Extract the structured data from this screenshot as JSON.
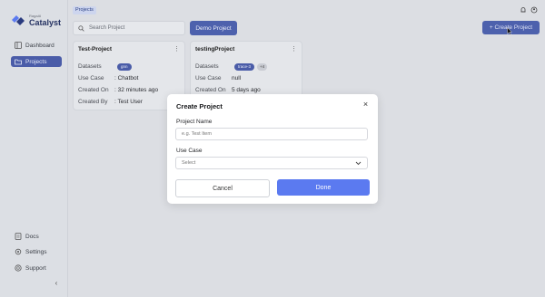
{
  "brand": {
    "line1": "RagaAI",
    "line2": "Catalyst"
  },
  "sidebar": {
    "items": [
      {
        "label": "Dashboard",
        "icon": "dashboard-icon",
        "active": false
      },
      {
        "label": "Projects",
        "icon": "folder-icon",
        "active": true
      }
    ],
    "bottom": [
      {
        "label": "Docs",
        "icon": "docs-icon"
      },
      {
        "label": "Settings",
        "icon": "gear-icon"
      },
      {
        "label": "Support",
        "icon": "support-icon"
      }
    ],
    "collapse_glyph": "‹"
  },
  "breadcrumb": "Projects",
  "search": {
    "placeholder": "Search Project"
  },
  "demo_button": "Demo Project",
  "create_button": "+ Create Project",
  "cards": [
    {
      "title": "Test-Project",
      "rows": [
        {
          "label": "Datasets",
          "value": "",
          "chips": [
            "gnn"
          ]
        },
        {
          "label": "Use Case",
          "value": ": Chatbot"
        },
        {
          "label": "Created On",
          "value": ": 32 minutes ago"
        },
        {
          "label": "Created By",
          "value": ": Test User"
        }
      ]
    },
    {
      "title": "testingProject",
      "rows": [
        {
          "label": "Datasets",
          "value": "",
          "chips": [
            "trace-3"
          ],
          "more": "+4"
        },
        {
          "label": "Use Case",
          "value": "null"
        },
        {
          "label": "Created On",
          "value": "5 days ago"
        }
      ]
    }
  ],
  "modal": {
    "title": "Create Project",
    "close": "×",
    "name_label": "Project Name",
    "name_placeholder": "e.g. Test Item",
    "usecase_label": "Use Case",
    "usecase_value": "Select",
    "cancel": "Cancel",
    "done": "Done"
  },
  "colors": {
    "accent": "#4d61ad",
    "done": "#5b7af0",
    "overlay": "#dcdee3"
  }
}
